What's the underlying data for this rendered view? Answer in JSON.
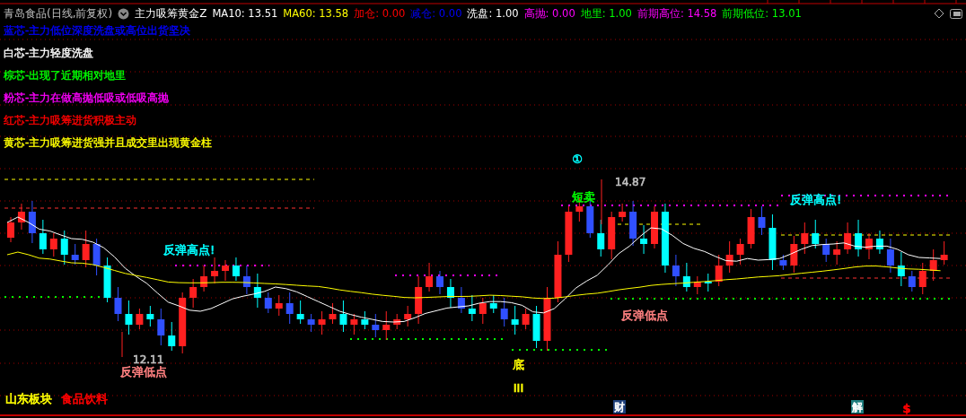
{
  "header": {
    "stock": "青岛食品(日线,前复权)",
    "indicator": "主力吸筹黄金Z",
    "values": [
      {
        "label": "MA10:",
        "value": "13.51",
        "color": "#ffffff"
      },
      {
        "label": "MA60:",
        "value": "13.58",
        "color": "#ffff00"
      },
      {
        "label": "加仓:",
        "value": "0.00",
        "color": "#ff0000"
      },
      {
        "label": "减仓:",
        "value": "0.00",
        "color": "#0000ff"
      },
      {
        "label": "洗盘:",
        "value": "1.00",
        "color": "#ffffff"
      },
      {
        "label": "高抛:",
        "value": "0.00",
        "color": "#ff00ff"
      },
      {
        "label": "地里:",
        "value": "1.00",
        "color": "#00ff00"
      },
      {
        "label": "前期高位:",
        "value": "14.58",
        "color": "#ff00ff"
      },
      {
        "label": "前期低位:",
        "value": "13.01",
        "color": "#00ff00"
      }
    ]
  },
  "legend": [
    {
      "text": "蓝芯-主力低位深度洗盘或高位出货坚决",
      "color": "#0000ff"
    },
    {
      "text": "白芯-主力轻度洗盘",
      "color": "#ffffff"
    },
    {
      "text": "棕芯-出现了近期相对地里",
      "color": "#00ff00"
    },
    {
      "text": "粉芯-主力在做高抛低吸或低吸高抛",
      "color": "#ff00ff"
    },
    {
      "text": "红芯-主力吸筹进货积极主动",
      "color": "#ff0000"
    },
    {
      "text": "黄芯-主力吸筹进货强并且成交里出现黄金柱",
      "color": "#ffff00"
    }
  ],
  "annotations": [
    {
      "kind": "signal",
      "text": "①",
      "color": "#00ffff"
    },
    {
      "kind": "price",
      "text": "14.87",
      "color": "#c0c0c0"
    },
    {
      "kind": "label",
      "text": "短卖",
      "color": "#00ff00"
    },
    {
      "kind": "label",
      "text": "反弹高点!",
      "color": "#00ffff"
    },
    {
      "kind": "label",
      "text": "反弹高点!",
      "color": "#00ffff"
    },
    {
      "kind": "label",
      "text": "反弹低点",
      "color": "#ff8080"
    },
    {
      "kind": "price",
      "text": "12.11",
      "color": "#c0c0c0"
    },
    {
      "kind": "label",
      "text": "反弹低点",
      "color": "#ff8080"
    },
    {
      "kind": "label",
      "text": "底",
      "color": "#ffff00"
    },
    {
      "kind": "label",
      "text": "III",
      "color": "#ffff00"
    }
  ],
  "footer": {
    "sector": "山东板块",
    "industry": "食品饮料"
  },
  "markers": [
    {
      "kind": "box",
      "text": "财",
      "color": "#1e3f7a"
    },
    {
      "kind": "box",
      "text": "解",
      "color": "#1c7c7c"
    },
    {
      "kind": "plain",
      "text": "$",
      "color": "#ff0000"
    }
  ]
}
